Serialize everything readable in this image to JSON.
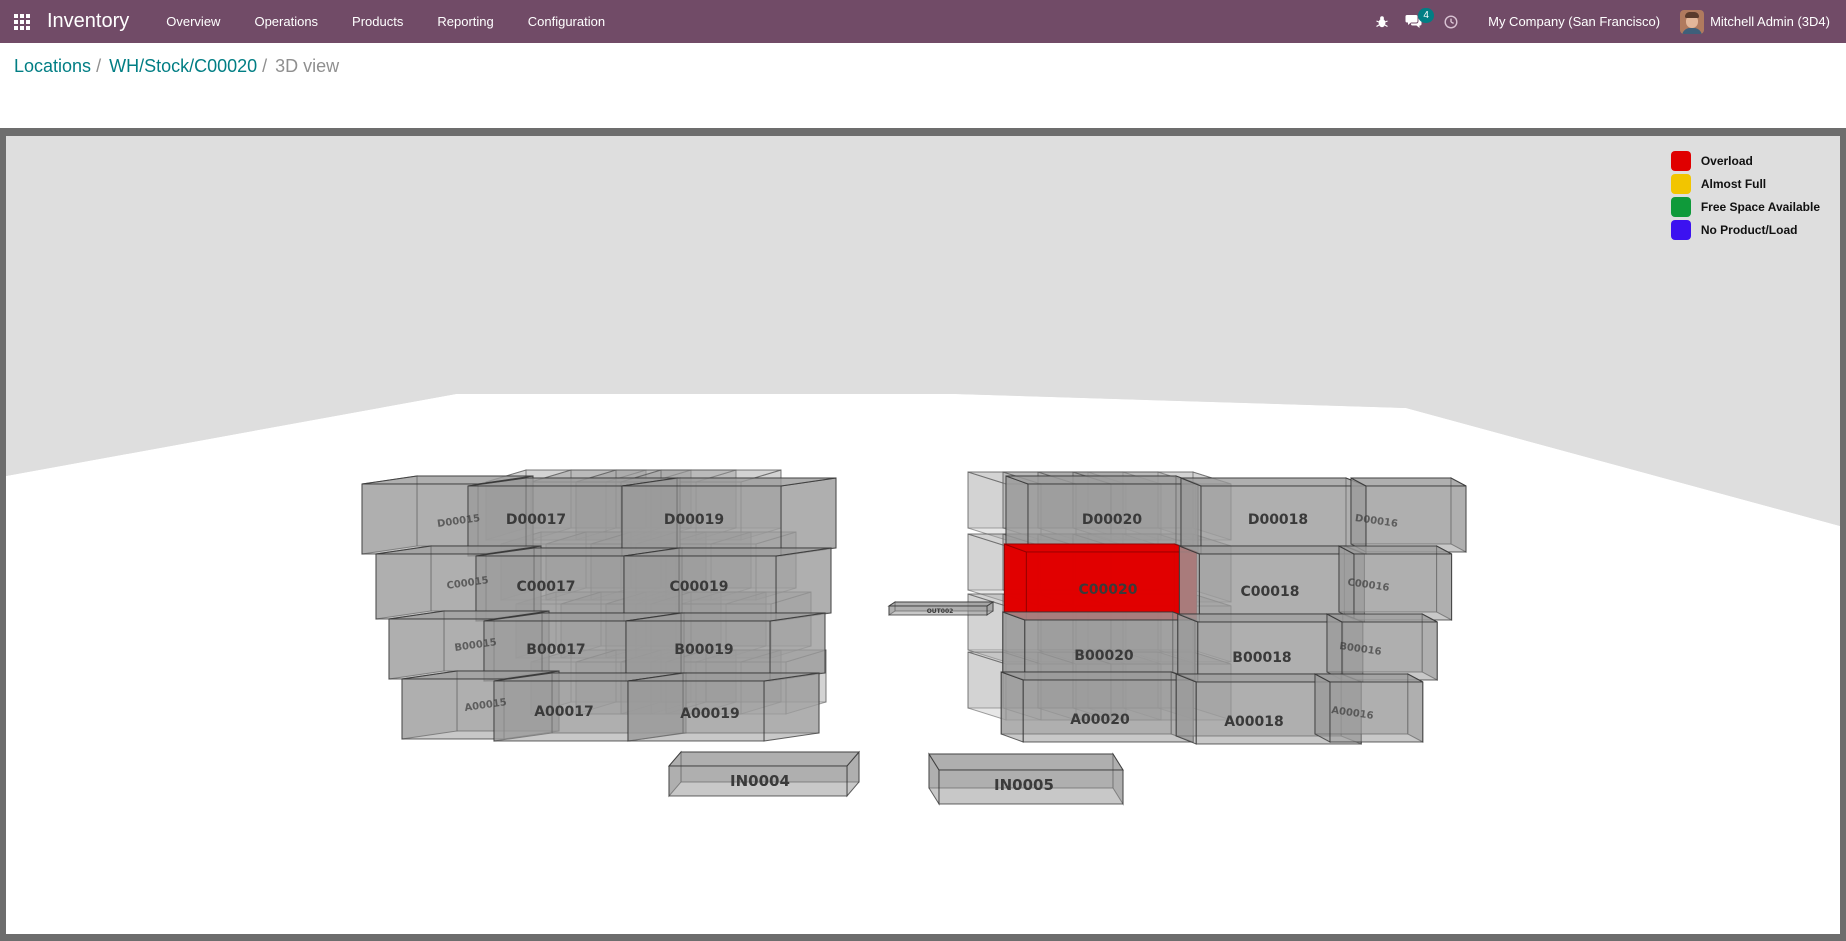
{
  "navbar": {
    "app_name": "Inventory",
    "menu": [
      "Overview",
      "Operations",
      "Products",
      "Reporting",
      "Configuration"
    ],
    "messages_count": "4",
    "company": "My Company (San Francisco)",
    "user": "Mitchell Admin (3D4)"
  },
  "breadcrumb": {
    "items": [
      "Locations",
      "WH/Stock/C00020"
    ],
    "current": "3D view"
  },
  "legend": [
    {
      "label": "Overload",
      "color": "#e00000"
    },
    {
      "label": "Almost Full",
      "color": "#f2c500"
    },
    {
      "label": "Free Space Available",
      "color": "#0f9a3a"
    },
    {
      "label": "No Product/Load",
      "color": "#3c12f0"
    }
  ],
  "locations": {
    "left_rack": [
      "D00017",
      "D00019",
      "C00017",
      "C00019",
      "B00017",
      "B00019",
      "A00017",
      "A00019"
    ],
    "right_rack": [
      "D00020",
      "D00018",
      "C00020",
      "C00018",
      "B00020",
      "B00018",
      "A00020",
      "A00018"
    ],
    "floor": [
      "IN0004",
      "IN0005",
      "OUT002"
    ],
    "back_left": [
      "D00015",
      "C00015",
      "B00015",
      "A00015"
    ],
    "back_right": [
      "D00016",
      "C00016",
      "B00016",
      "A00016"
    ],
    "selected": "C00020"
  }
}
